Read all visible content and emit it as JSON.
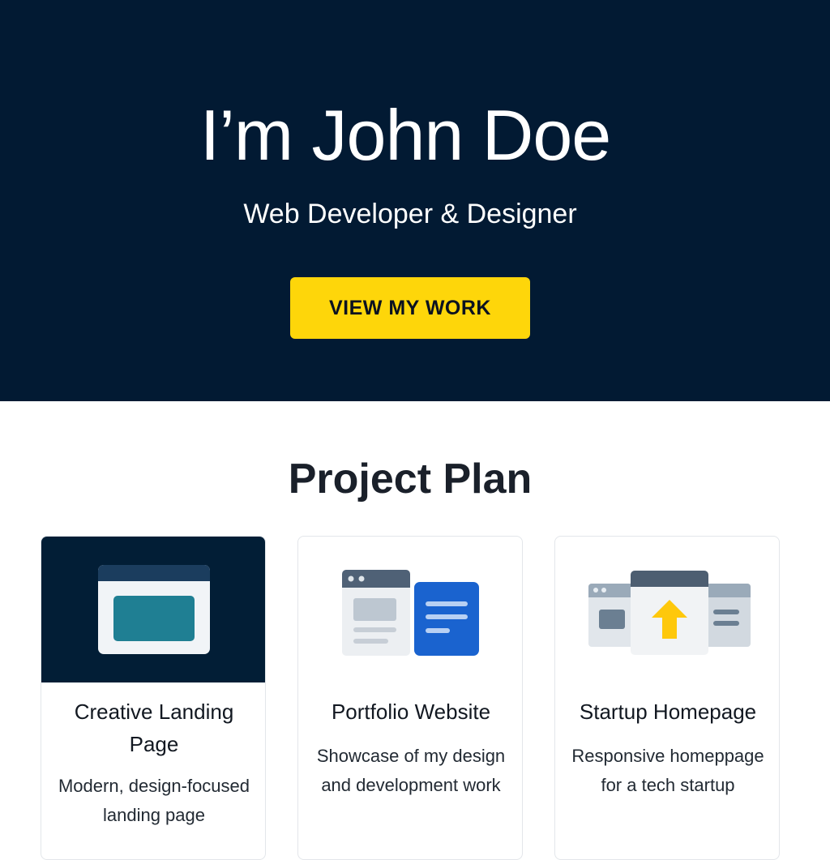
{
  "hero": {
    "title": "I’m John Doe",
    "subtitle": "Web Developer & Designer",
    "cta_label": "VIEW MY WORK"
  },
  "projects": {
    "section_title": "Project Plan",
    "cards": [
      {
        "title": "Creative Landing Page",
        "description": "Modern, design-focused landing page",
        "icon": "browser-window-icon"
      },
      {
        "title": "Portfolio Website",
        "description": "Showcase of my design and development work",
        "icon": "portfolio-pages-icon"
      },
      {
        "title": "Startup Homepage",
        "description": "Responsive homeppage for a tech startup",
        "icon": "startup-launch-icon"
      }
    ]
  },
  "colors": {
    "hero_background": "#021a33",
    "accent": "#fed60a",
    "card_border": "#e3e6ea"
  }
}
